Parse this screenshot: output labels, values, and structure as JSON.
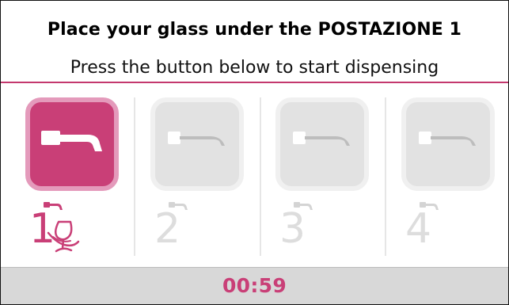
{
  "header": {
    "title": "Place your glass under the POSTAZIONE 1",
    "instruction": "Press the button below to start dispensing"
  },
  "stations": [
    {
      "number": "1",
      "active": true,
      "icon": "tap-icon"
    },
    {
      "number": "2",
      "active": false,
      "icon": "tap-icon"
    },
    {
      "number": "3",
      "active": false,
      "icon": "tap-icon"
    },
    {
      "number": "4",
      "active": false,
      "icon": "tap-icon"
    }
  ],
  "footer": {
    "timer": "00:59"
  },
  "colors": {
    "accent": "#c93f77",
    "accent_light": "#e49abb",
    "inactive_tile": "#e2e2e2",
    "footer_background": "#d8d8d8"
  }
}
